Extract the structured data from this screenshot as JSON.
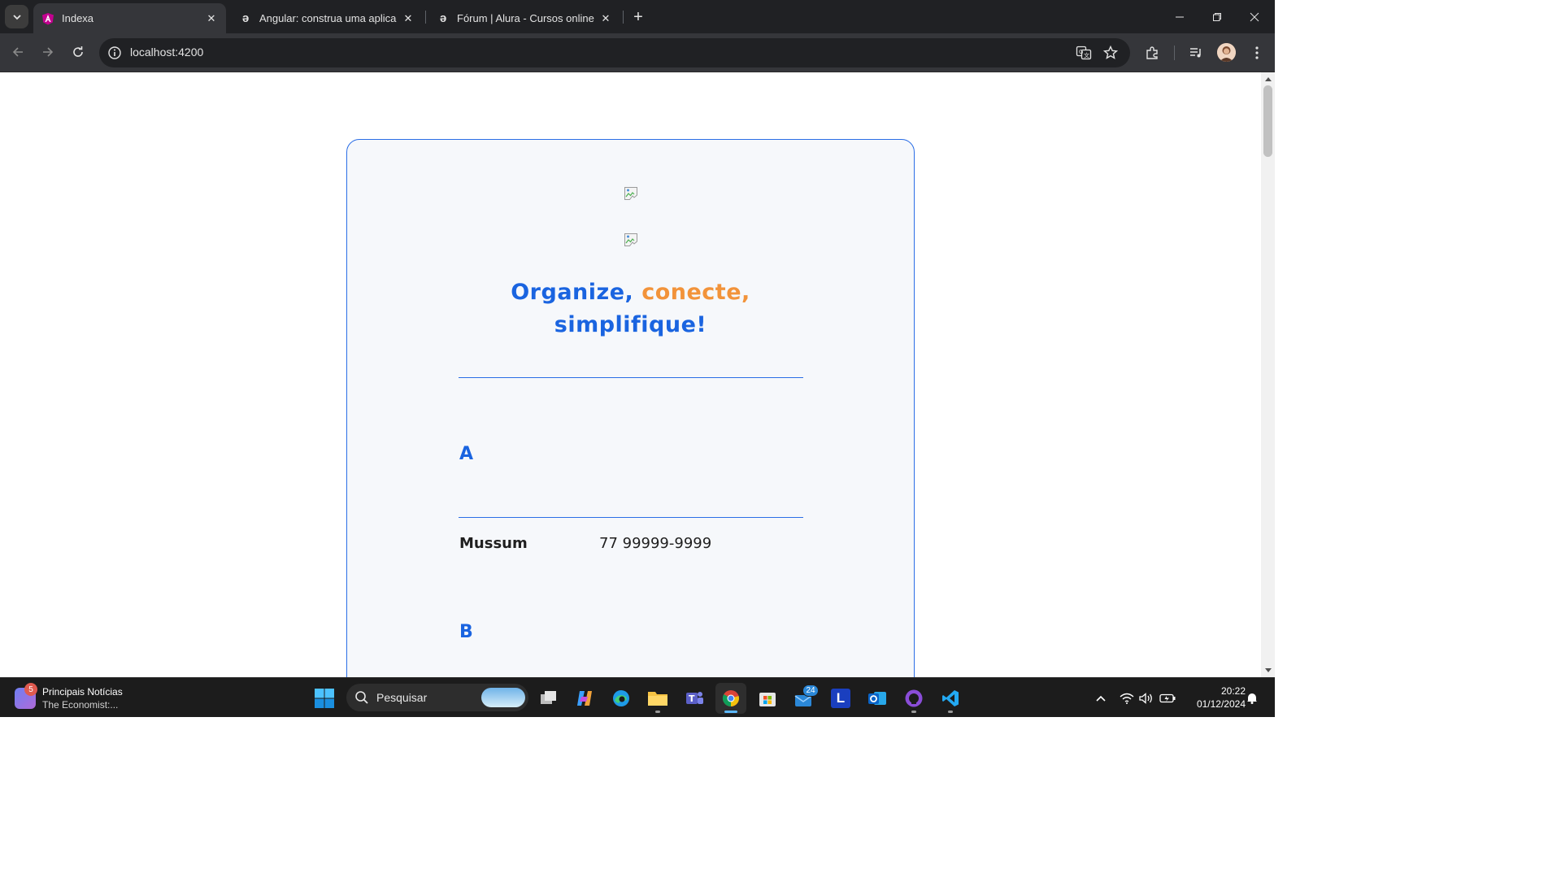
{
  "browser": {
    "tabs": [
      {
        "title": "Indexa",
        "icon": "angular-icon",
        "active": true
      },
      {
        "title": "Angular: construa uma aplicaçã",
        "icon": "alura-icon",
        "active": false
      },
      {
        "title": "Fórum | Alura - Cursos online d",
        "icon": "alura-icon",
        "active": false
      }
    ],
    "url": "localhost:4200"
  },
  "page": {
    "headline_part1": "Organize, ",
    "headline_part2": "conecte,",
    "headline_part3": "simplifique!",
    "groups": [
      {
        "letter": "A",
        "contacts": [
          {
            "name": "Mussum",
            "phone": "77 99999-9999"
          }
        ]
      },
      {
        "letter": "B",
        "contacts": []
      }
    ],
    "colors": {
      "primary": "#1a64e0",
      "accent": "#f2933a",
      "card_bg": "#f6f8fb"
    }
  },
  "taskbar": {
    "news_title": "Principais Notícias",
    "news_subtitle": "The Economist:...",
    "news_badge": "5",
    "search_placeholder": "Pesquisar",
    "mail_badge": "24",
    "time": "20:22",
    "date": "01/12/2024"
  }
}
